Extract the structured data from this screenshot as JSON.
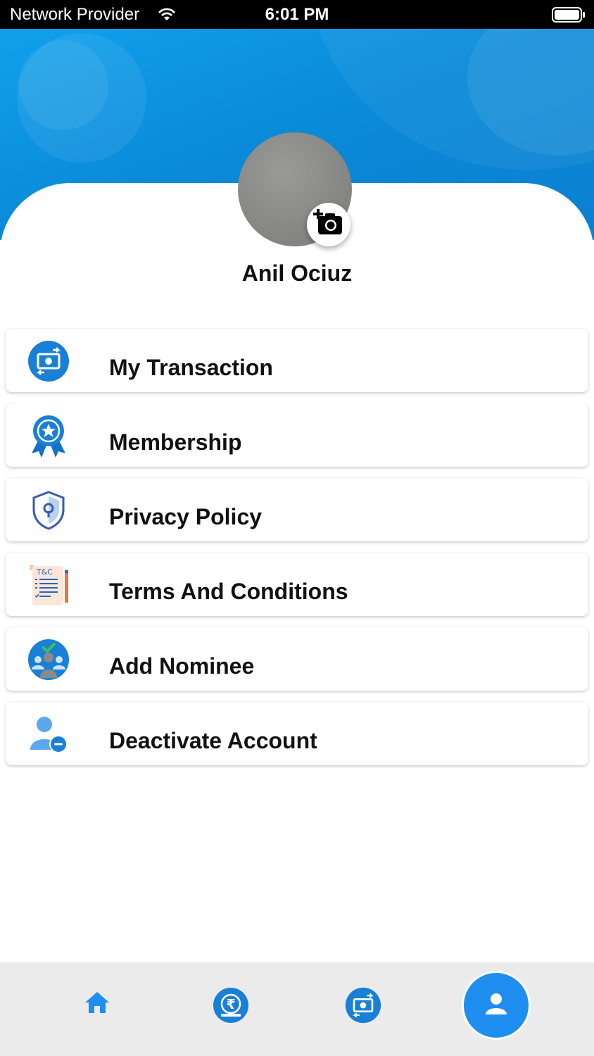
{
  "status_bar": {
    "carrier": "Network Provider",
    "time": "6:01 PM"
  },
  "profile": {
    "name": "Anil Ociuz",
    "avatar_icon": "avatar",
    "camera_icon": "add-photo-icon"
  },
  "menu": {
    "items": [
      {
        "label": "My Transaction",
        "icon": "money-transfer-icon"
      },
      {
        "label": "Membership",
        "icon": "award-ribbon-icon"
      },
      {
        "label": "Privacy Policy",
        "icon": "shield-lock-icon"
      },
      {
        "label": "Terms And Conditions",
        "icon": "terms-document-icon"
      },
      {
        "label": "Add Nominee",
        "icon": "group-user-icon"
      },
      {
        "label": "Deactivate Account",
        "icon": "user-remove-icon"
      }
    ]
  },
  "bottom_nav": {
    "items": [
      {
        "icon": "home-icon",
        "active": false
      },
      {
        "icon": "rupee-icon",
        "active": false
      },
      {
        "icon": "money-transfer-icon",
        "active": false
      },
      {
        "icon": "profile-icon",
        "active": true
      }
    ]
  },
  "colors": {
    "primary": "#1e8ef0",
    "header_blue": "#0a8ad8",
    "icon_blue": "#1a7fd6"
  }
}
